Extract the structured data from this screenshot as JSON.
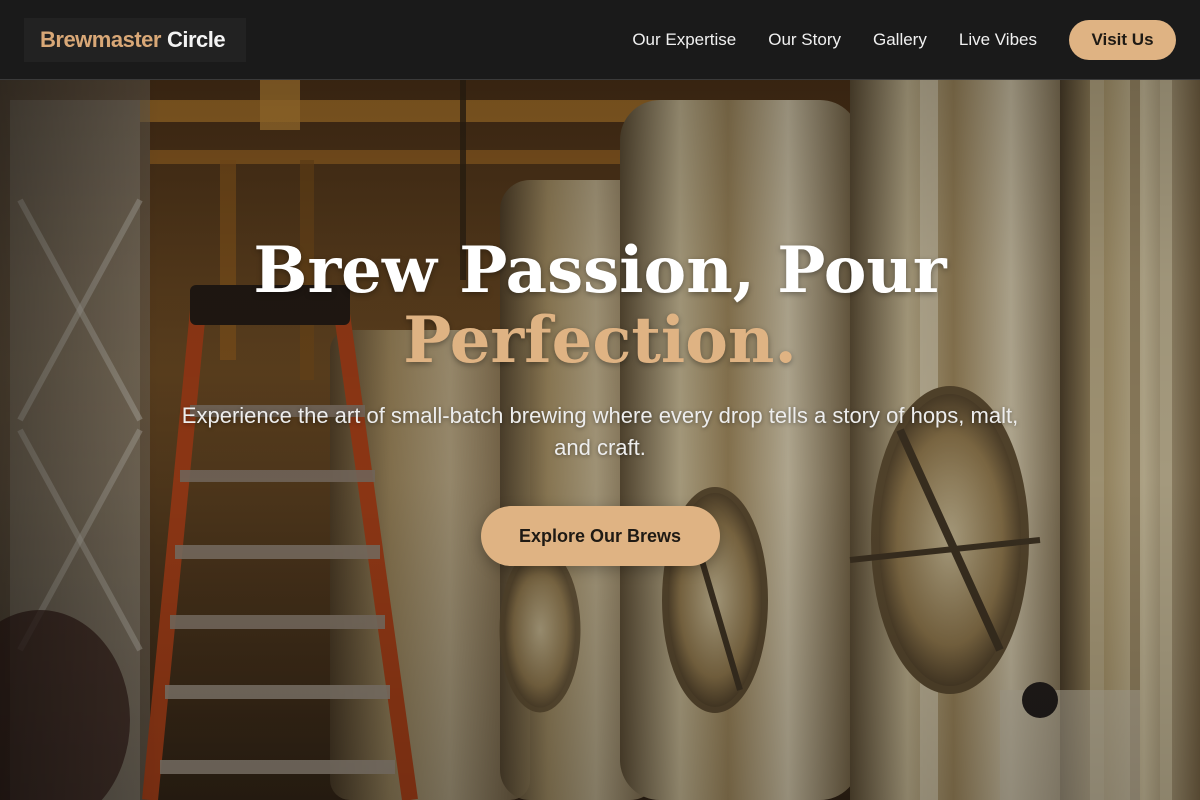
{
  "header": {
    "brand_primary": "Brewmaster",
    "brand_secondary": "Circle",
    "nav": [
      {
        "label": "Our Expertise"
      },
      {
        "label": "Our Story"
      },
      {
        "label": "Gallery"
      },
      {
        "label": "Live Vibes"
      }
    ],
    "cta_label": "Visit Us"
  },
  "hero": {
    "headline_line1": "Brew Passion, Pour",
    "headline_line2": "Perfection.",
    "subtitle": "Experience the art of small-batch brewing where every drop tells a story of hops, malt, and craft.",
    "cta_label": "Explore Our Brews"
  },
  "colors": {
    "accent": "#dfb383",
    "header_bg": "#1a1a1a",
    "text_light": "#ffffff"
  }
}
